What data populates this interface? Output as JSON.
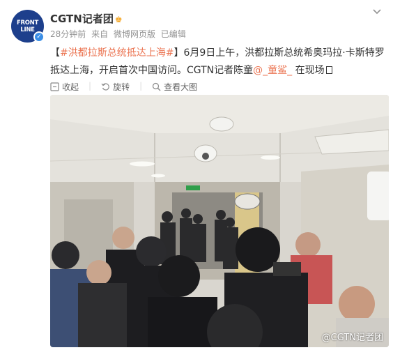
{
  "account": {
    "name": "CGTN记者团",
    "avatar_line1": "FRONT",
    "avatar_line2": "LINE",
    "verified_badge": "✓"
  },
  "meta": {
    "time": "28分钟前",
    "source_prefix": "来自",
    "source": "微博网页版",
    "edited": "已编辑"
  },
  "post": {
    "bracket_open": "【",
    "topic": "#洪都拉斯总统抵达上海#",
    "bracket_close": "】",
    "text": "6月9日上午，洪都拉斯总统希奥玛拉·卡斯特罗抵达上海，开启首次中国访问。CGTN记者陈童",
    "mention": "@_童鲨_",
    "text_end": " 在现场"
  },
  "actions": {
    "collapse": "收起",
    "rotate": "旋转",
    "view_full": "查看大图"
  },
  "image": {
    "watermark": "@CGTN记者团"
  },
  "colors": {
    "link": "#eb7350",
    "meta": "#939393",
    "avatar_bg": "#1d3f8c"
  }
}
